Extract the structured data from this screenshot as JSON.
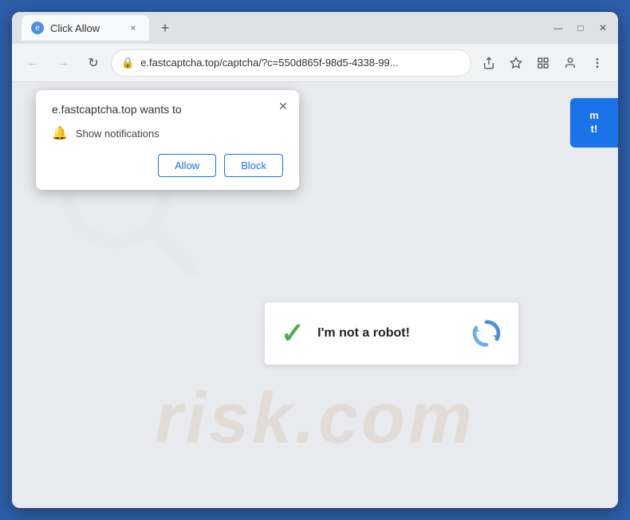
{
  "browser": {
    "title": "Click Allow",
    "tab": {
      "favicon_text": "e",
      "title": "Click Allow",
      "close_label": "×"
    },
    "new_tab_label": "+",
    "nav": {
      "back_label": "←",
      "forward_label": "→",
      "refresh_label": "↻"
    },
    "address_bar": {
      "url": "e.fastcaptcha.top/captcha/?c=550d865f-98d5-4338-99...",
      "lock_icon": "🔒"
    },
    "window_controls": {
      "minimize": "—",
      "maximize": "□",
      "close": "✕"
    }
  },
  "notification_popup": {
    "title": "e.fastcaptcha.top wants to",
    "notification_label": "Show notifications",
    "allow_label": "Allow",
    "block_label": "Block",
    "close_label": "✕"
  },
  "blue_cta": {
    "line1": "m",
    "line2": "t!"
  },
  "recaptcha": {
    "label": "I'm not a robot!",
    "check": "✓"
  },
  "watermark": {
    "text": "risk.com"
  }
}
